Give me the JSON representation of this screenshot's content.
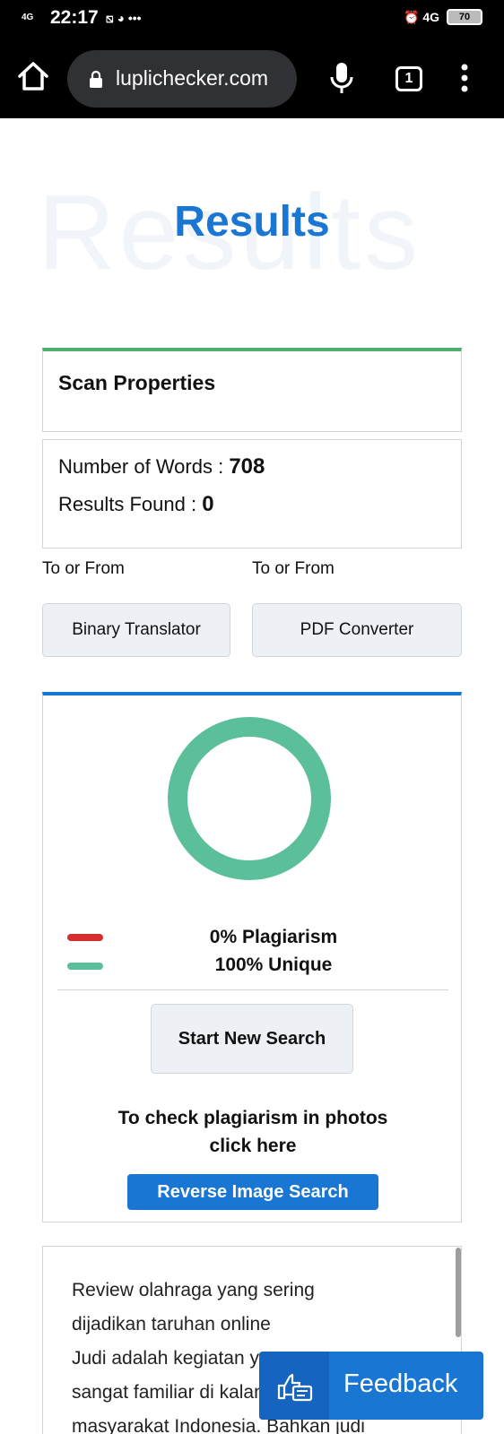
{
  "status_bar": {
    "signal": "4G",
    "time": "22:17",
    "indicators": "⧅ ◕ •••",
    "right_indicators": "⏰ 4G",
    "battery": "70"
  },
  "browser": {
    "url": "luplichecker.com",
    "tab_count": "1"
  },
  "page": {
    "heading_background": "Results",
    "heading": "Results"
  },
  "scan_properties": {
    "title": "Scan Properties"
  },
  "stats": {
    "words_label": "Number of Words : ",
    "words_value": "708",
    "results_label": "Results Found : ",
    "results_value": "0"
  },
  "tools": {
    "left_caption": "To or From",
    "left_button": "Binary Translator",
    "right_caption": "To or From",
    "right_button": "PDF Converter"
  },
  "result": {
    "chart_data": {
      "type": "pie",
      "categories": [
        "Plagiarism",
        "Unique"
      ],
      "values": [
        0,
        100
      ],
      "colors": [
        "#d32f2f",
        "#5bbf9a"
      ]
    },
    "plagiarism_label": "0% Plagiarism",
    "unique_label": "100% Unique",
    "plagiarism_color": "#d32f2f",
    "unique_color": "#5bbf9a",
    "new_search_button": "Start New Search",
    "photo_line1": "To check plagiarism in photos",
    "photo_line2": "click here",
    "reverse_button": "Reverse Image Search"
  },
  "text_preview": {
    "line1": "Review olahraga yang sering",
    "line2": "dijadikan taruhan online",
    "line3": "Judi adalah kegiatan yang",
    "line4": "sangat familiar di kalangan",
    "line5": "masyarakat Indonesia. Bahkan judi"
  },
  "feedback": {
    "label": "Feedback"
  }
}
